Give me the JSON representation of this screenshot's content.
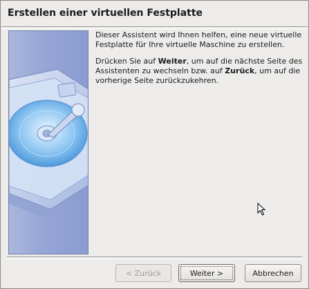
{
  "dialog": {
    "title": "Erstellen einer virtuellen Festplatte"
  },
  "content": {
    "intro": "Dieser Assistent wird Ihnen helfen, eine neue virtuelle Festplatte für Ihre virtuelle Maschine zu erstellen.",
    "nav_prefix": "Drücken Sie auf ",
    "nav_next": "Weiter",
    "nav_mid": ", um auf die nächste Seite des Assistenten zu wechseln bzw. auf ",
    "nav_back": "Zurück",
    "nav_suffix": ", um auf die vorherige Seite zurückzukehren."
  },
  "buttons": {
    "back_label": "< Zurück",
    "next_label": "Weiter >",
    "cancel_label": "Abbrechen"
  },
  "colors": {
    "watermark_blue": "#97a6d6",
    "dialog_bg": "#edeceb"
  },
  "icons": [
    "hard-disk-icon",
    "mouse-cursor-icon"
  ]
}
